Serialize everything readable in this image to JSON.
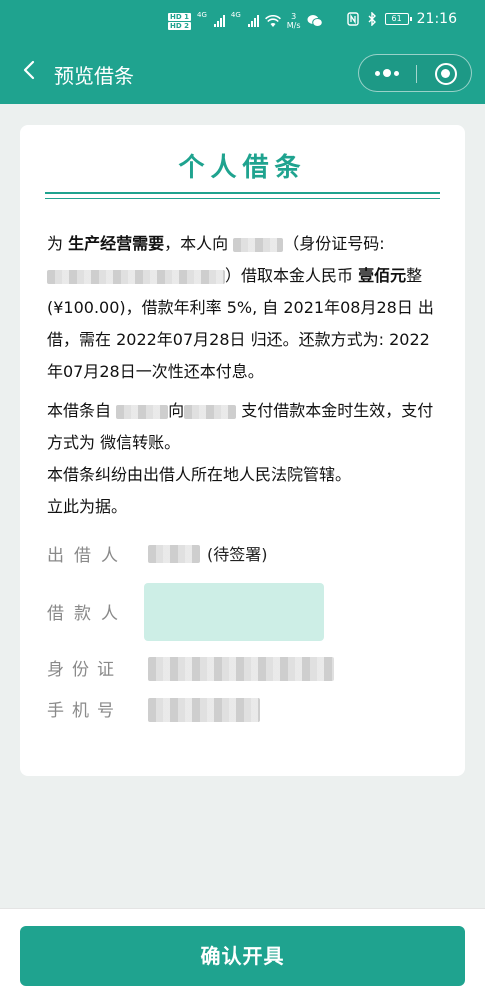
{
  "status_bar": {
    "hd1": "HD 1",
    "hd2": "HD 2",
    "signal1_label": "4G",
    "signal2_label": "4G",
    "speed_value": "3",
    "speed_unit": "M/s",
    "battery": "61",
    "time": "21:16"
  },
  "nav": {
    "title": "预览借条",
    "back_icon": "chevron-left-icon",
    "more_icon": "more-dots-icon",
    "close_icon": "mini-program-close-icon"
  },
  "document": {
    "title": "个人借条",
    "p1": {
      "s1": "为 ",
      "purpose": "生产经营需要",
      "s2": "，本人向 ",
      "s3": "（身份证号码:",
      "s4": "）借取本金人民币 ",
      "amount_text": "壹佰元",
      "s5": "整(¥100.00)，借款年利率 5%, 自 2021年08月28日 出借，需在 2022年07月28日 归还。还款方式为: 2022年07月28日一次性还本付息。"
    },
    "p2": {
      "s1": "本借条自 ",
      "s2": "向",
      "s3": " 支付借款本金时生效，支付方式为 微信转账。",
      "line2": "本借条纠纷由出借人所在地人民法院管辖。",
      "line3": "立此为据。"
    }
  },
  "fields": {
    "lender_label": "出借人",
    "lender_status": "(待签署)",
    "borrower_label": "借款人",
    "id_label": "身份证",
    "phone_label": "手机号"
  },
  "footer": {
    "confirm_label": "确认开具"
  },
  "colors": {
    "accent": "#1fa38f",
    "signature_box": "#cdeee6",
    "background": "#ecf0ef"
  }
}
